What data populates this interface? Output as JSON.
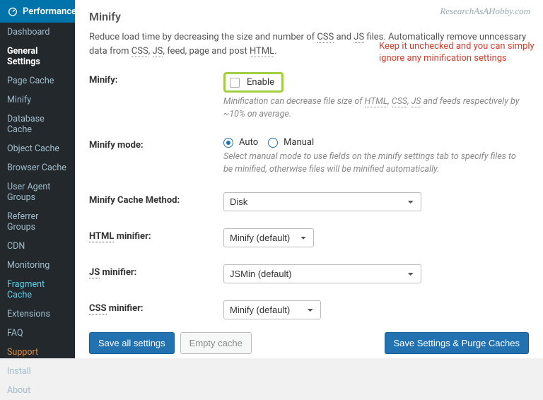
{
  "watermark": "ResearchAsAHobby.com",
  "sidebar": {
    "header": "Performance",
    "items": [
      "Dashboard",
      "General Settings",
      "Page Cache",
      "Minify",
      "Database Cache",
      "Object Cache",
      "Browser Cache",
      "User Agent Groups",
      "Referrer Groups",
      "CDN",
      "Monitoring",
      "Fragment Cache",
      "Extensions",
      "FAQ",
      "Support",
      "Install",
      "About"
    ]
  },
  "page": {
    "title": "Minify",
    "intro_pre": "Reduce load time by decreasing the size and number of ",
    "css": "CSS",
    "and": " and ",
    "js": "JS",
    "intro_mid": " files. Automatically remove unncessary data from ",
    "intro_sep": ", ",
    "intro_post": ", feed, page and post ",
    "html": "HTML",
    "intro_end": "."
  },
  "annotation": "Keep it unchecked and you can simply ignore any minification settings",
  "rows": {
    "minify": {
      "label": "Minify:",
      "enable": "Enable",
      "desc_pre": "Minification can decrease file size of ",
      "desc_post": " and feeds respectively by ~10% on average."
    },
    "mode": {
      "label": "Minify mode:",
      "auto": "Auto",
      "manual": "Manual",
      "desc": "Select manual mode to use fields on the minify settings tab to specify files to be minified, otherwise files will be minified automatically."
    },
    "cache": {
      "label": "Minify Cache Method:",
      "value": "Disk"
    },
    "html": {
      "label_pre": "HTML",
      "label_post": " minifier:",
      "value": "Minify (default)"
    },
    "jsm": {
      "label_pre": "JS",
      "label_post": " minifier:",
      "value": "JSMin (default)"
    },
    "cssm": {
      "label_pre": "CSS",
      "label_post": " minifier:",
      "value": "Minify (default)"
    }
  },
  "buttons": {
    "save_all": "Save all settings",
    "empty": "Empty cache",
    "save_purge": "Save Settings & Purge Caches"
  }
}
